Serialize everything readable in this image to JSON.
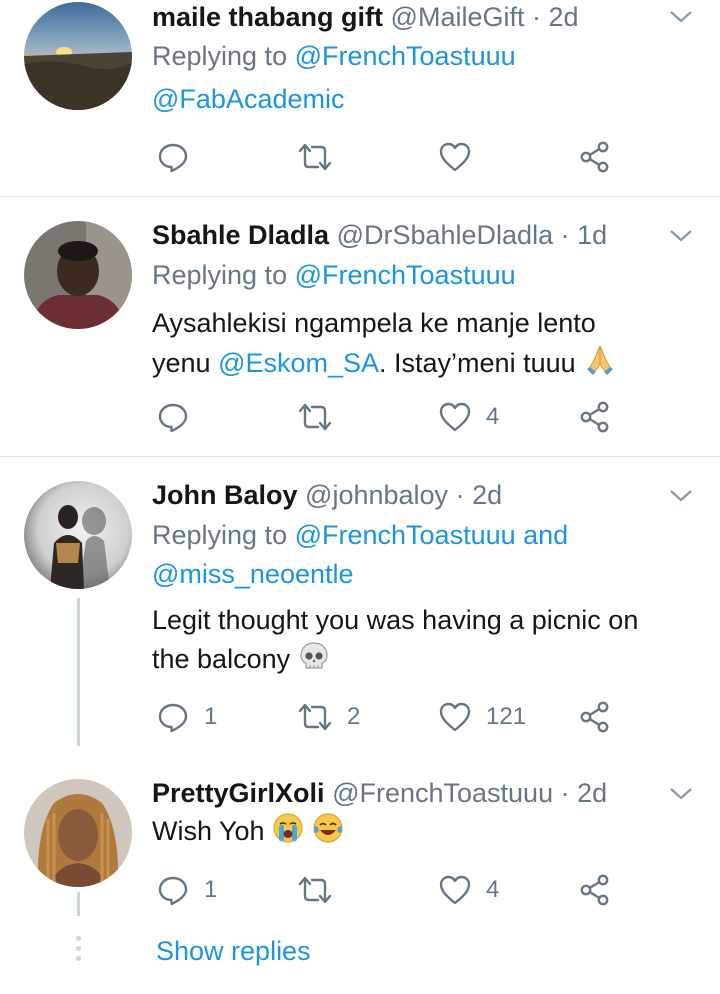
{
  "tweets": [
    {
      "name": "maile thabang gift",
      "handle": "@MaileGift",
      "dot": "·",
      "time": "2d",
      "reply_prefix": "Replying to ",
      "reply_mention_1": "@FrenchToastuuu",
      "reply_mention_2": "@FabAcademic",
      "actions": {
        "reply": "",
        "retweet": "",
        "like": ""
      }
    },
    {
      "name": "Sbahle Dladla",
      "handle": "@DrSbahleDladla",
      "dot": "·",
      "time": "1d",
      "reply_prefix": "Replying to ",
      "reply_mention_1": "@FrenchToastuuu",
      "text_line1": "Aysahlekisi ngampela ke manje lento",
      "text_line2_a": "yenu ",
      "text_line2_mention": "@Eskom_SA",
      "text_line2_b": ". Istay’meni tuuu",
      "actions": {
        "reply": "",
        "retweet": "",
        "like": "4"
      }
    },
    {
      "name": "John Baloy",
      "handle": "@johnbaloy",
      "dot": "·",
      "time": "2d",
      "reply_prefix": "Replying to ",
      "reply_mention_1": "@FrenchToastuuu",
      "reply_and": " and",
      "reply_mention_2": "@miss_neoentle",
      "text_line1": "Legit thought you was having a picnic on",
      "text_line2": "the balcony",
      "actions": {
        "reply": "1",
        "retweet": "2",
        "like": "121"
      }
    },
    {
      "name": "PrettyGirlXoli",
      "handle": "@FrenchToastuuu",
      "dot": "·",
      "time": "2d",
      "text_line1": "Wish Yoh",
      "actions": {
        "reply": "1",
        "retweet": "",
        "like": "4"
      }
    }
  ],
  "show_replies": "Show replies",
  "icons": {
    "reply": "reply-icon",
    "retweet": "retweet-icon",
    "like": "heart-icon",
    "share": "share-icon",
    "caret": "chevron-down-icon",
    "emoji_pray": "folded-hands-emoji",
    "emoji_skull": "skull-emoji",
    "emoji_crying": "loudly-crying-emoji",
    "emoji_joy": "tears-of-joy-emoji"
  },
  "colors": {
    "link": "#1b95e0",
    "secondary": "#657786",
    "divider": "#e1e8ed",
    "text": "#14171a"
  }
}
